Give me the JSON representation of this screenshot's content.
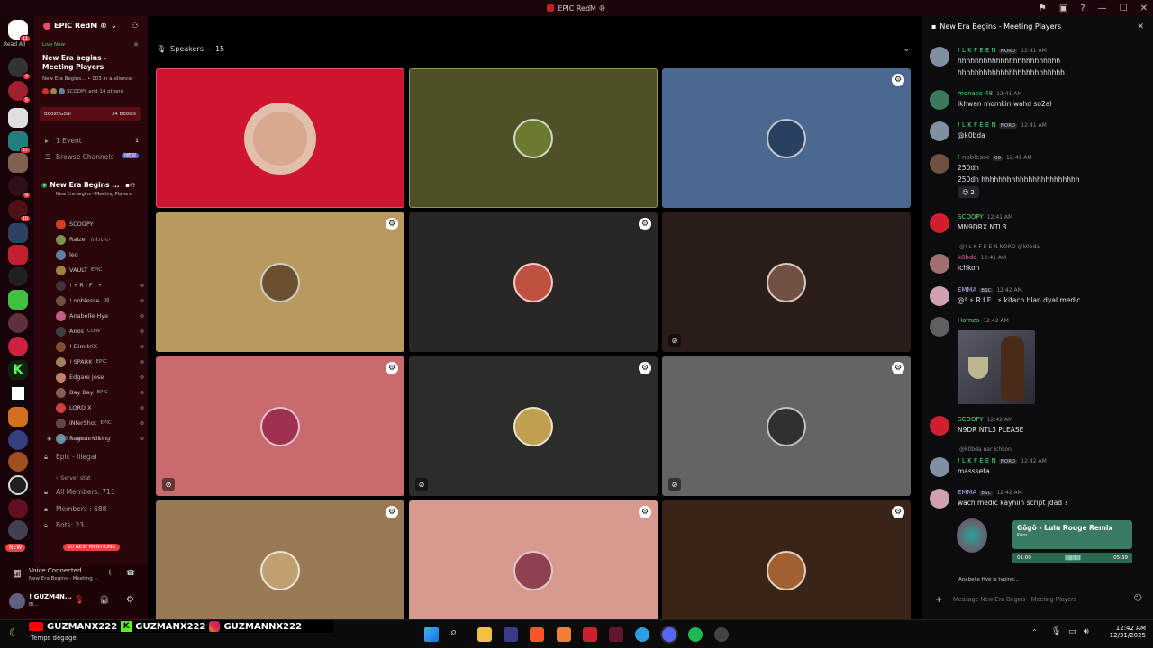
{
  "window": {
    "title": "EPIC RedM ®"
  },
  "rail": {
    "read_all": "Read All",
    "badges": [
      "11",
      "4",
      "5",
      "8",
      "37",
      "2",
      "9",
      "10",
      "18",
      "9",
      "4"
    ],
    "new_label": "NEW"
  },
  "sidebar": {
    "server_name": "EPIC RedM ®",
    "live_label": "Live Now",
    "stage_title": "New Era begins - Meeting Players",
    "stage_sub": "New Era Begins... • 103 in audience",
    "stage_people": "SCOOPY and 14 others",
    "boost_goal": "Boost Goal",
    "boosts": "34 Boosts",
    "event": "1 Event",
    "event_count": "1",
    "browse": "Browse Channels",
    "browse_badge": "NEW",
    "channel_name": "New Era Begins ...",
    "channel_sub": "New Era begins - Meeting Players",
    "members": [
      {
        "name": "SCOOPY",
        "tag": ""
      },
      {
        "name": "Raizel",
        "tag": "かわいい"
      },
      {
        "name": "leo",
        "tag": ""
      },
      {
        "name": "VAULT",
        "tag": "EPIC"
      },
      {
        "name": "! ⚡ R I F I ⚡",
        "tag": ""
      },
      {
        "name": "! noblesse",
        "tag": "08"
      },
      {
        "name": "Anabelle Hye",
        "tag": ""
      },
      {
        "name": "Anos",
        "tag": "COIN"
      },
      {
        "name": "! DimitriX",
        "tag": ""
      },
      {
        "name": "! SPARK",
        "tag": "EPIC"
      },
      {
        "name": "Edgare Jose",
        "tag": ""
      },
      {
        "name": "Bay Bay",
        "tag": "EPIC"
      },
      {
        "name": "LORD X",
        "tag": ""
      },
      {
        "name": "iNferShot",
        "tag": "EPIC"
      },
      {
        "name": "Ragnar Viking",
        "tag": ""
      }
    ],
    "audience": "103 in audience",
    "ch_illegal": "Epic - illegal",
    "server_stat": "Server stat",
    "all_members": "All Members: 711",
    "members_count": "Members : 688",
    "bots": "Bots: 23",
    "new_mentions": "10 NEW MENTIONS",
    "voice_connected": "Voice Connected",
    "voice_channel": "New Era Begins - Meeting ...",
    "user_name": "! GUZM4N...",
    "user_status": "Bl..."
  },
  "main": {
    "header": "Speakers — 15",
    "tiles": [
      {
        "bg": "#cf1430",
        "border": "#e05060",
        "gear": false,
        "mute": false,
        "avatar": "#d8a890"
      },
      {
        "bg": "#4f4f28",
        "border": "#8a9a50",
        "gear": false,
        "mute": false,
        "avatar": "#6a7a30"
      },
      {
        "bg": "#4b6890",
        "border": "#4b6890",
        "gear": true,
        "mute": false,
        "avatar": "#2a4060"
      },
      {
        "bg": "#b89a5e",
        "border": "#b89a5e",
        "gear": true,
        "mute": false,
        "avatar": "#6a5030"
      },
      {
        "bg": "#2a2624",
        "border": "#2a2624",
        "gear": true,
        "mute": false,
        "avatar": "#c05040"
      },
      {
        "bg": "#2a1c18",
        "border": "#2a1c18",
        "gear": false,
        "mute": true,
        "avatar": "#705040"
      },
      {
        "bg": "#c86a6e",
        "border": "#c86a6e",
        "gear": true,
        "mute": true,
        "avatar": "#a03050"
      },
      {
        "bg": "#2c2c2a",
        "border": "#2c2c2a",
        "gear": true,
        "mute": true,
        "avatar": "#c0a050"
      },
      {
        "bg": "#646464",
        "border": "#646464",
        "gear": true,
        "mute": true,
        "avatar": "#303030"
      },
      {
        "bg": "#9a7a56",
        "border": "#9a7a56",
        "gear": true,
        "mute": false,
        "avatar": "#c0a070"
      },
      {
        "bg": "#d69a8e",
        "border": "#d69a8e",
        "gear": true,
        "mute": false,
        "avatar": "#904050"
      },
      {
        "bg": "#3a2418",
        "border": "#3a2418",
        "gear": true,
        "mute": false,
        "avatar": "#a06030"
      }
    ]
  },
  "chat": {
    "title": "New Era Begins - Meeting Players",
    "messages": [
      {
        "name": "! L K F E E N",
        "color": "#4ed87a",
        "tag": "NORD",
        "time": "12:41 AM",
        "text": "hhhhhhhhhhhhhhhhhhhhhhhh",
        "text2": "hhhhhhhhhhhhhhhhhhhhhhhhh",
        "avatar": "#8090a0"
      },
      {
        "name": "monaco 48",
        "color": "#4ed87a",
        "tag": "",
        "time": "12:41 AM",
        "text": "ikhwan momkin wahd so2al",
        "text2": "",
        "avatar": "#3a7a5a"
      },
      {
        "name": "! L K F E E N",
        "color": "#4ed87a",
        "tag": "NORD",
        "time": "12:41 AM",
        "text": "@k0bda",
        "text2": "",
        "avatar": "#8090a0"
      },
      {
        "name": "! noblesse",
        "color": "#8a8a8a",
        "tag": "08",
        "time": "12:41 AM",
        "text": "250dh",
        "text2": "250dh hhhhhhhhhhhhhhhhhhhhhhh",
        "avatar": "#705040"
      },
      {
        "name": "SCOOPY",
        "color": "#4ed87a",
        "tag": "",
        "time": "12:41 AM",
        "text": "MN9DRX  NTL3",
        "text2": "",
        "avatar": "#d02030"
      },
      {
        "name": "k0bda",
        "color": "#e060a0",
        "tag": "",
        "time": "12:41 AM",
        "text": "ichkon",
        "text2": "",
        "avatar": "#a07070"
      },
      {
        "name": "EMMA",
        "color": "#c0a0ff",
        "tag": "BSC",
        "time": "12:42 AM",
        "text": "@! ⚡ R I F I ⚡  kifach blan dyal medic",
        "text2": "",
        "avatar": "#d0a0b0"
      },
      {
        "name": "Hamza",
        "color": "#4ed87a",
        "tag": "",
        "time": "12:42 AM",
        "text": "",
        "text2": "",
        "avatar": "#606060"
      },
      {
        "name": "SCOOPY",
        "color": "#4ed87a",
        "tag": "",
        "time": "12:42 AM",
        "text": "N9DR NTL3 PLEASE",
        "text2": "",
        "avatar": "#d02030"
      },
      {
        "name": "! L K F E E N",
        "color": "#4ed87a",
        "tag": "NORD",
        "time": "12:42 AM",
        "text": "massseta",
        "text2": "",
        "avatar": "#8090a0"
      },
      {
        "name": "EMMA",
        "color": "#c0a0ff",
        "tag": "BSC",
        "time": "12:42 AM",
        "text": "wach medic kayniin script jdad ?",
        "text2": "",
        "avatar": "#d0a0b0"
      }
    ],
    "reaction": "2",
    "reply1": "@! L K F E E N  NORD  @k0bda",
    "reply2": "@k0bda  nar ichkon",
    "typing": "Anabelle Hye is typing...",
    "input_placeholder": "Message New Era Begins - Meeting Players",
    "music": {
      "title": "Gôgô - Lulu Rouge Remix",
      "artist": "Kûro",
      "time_start": "01:00",
      "time_end": "05:39"
    }
  },
  "overlay": {
    "names": [
      "GUZMANX222",
      "GUZMANX222",
      "GUZMANNX222"
    ],
    "weather": "Temps dégagé"
  },
  "taskbar": {
    "time": "12:42 AM",
    "date": "12/31/2025"
  }
}
